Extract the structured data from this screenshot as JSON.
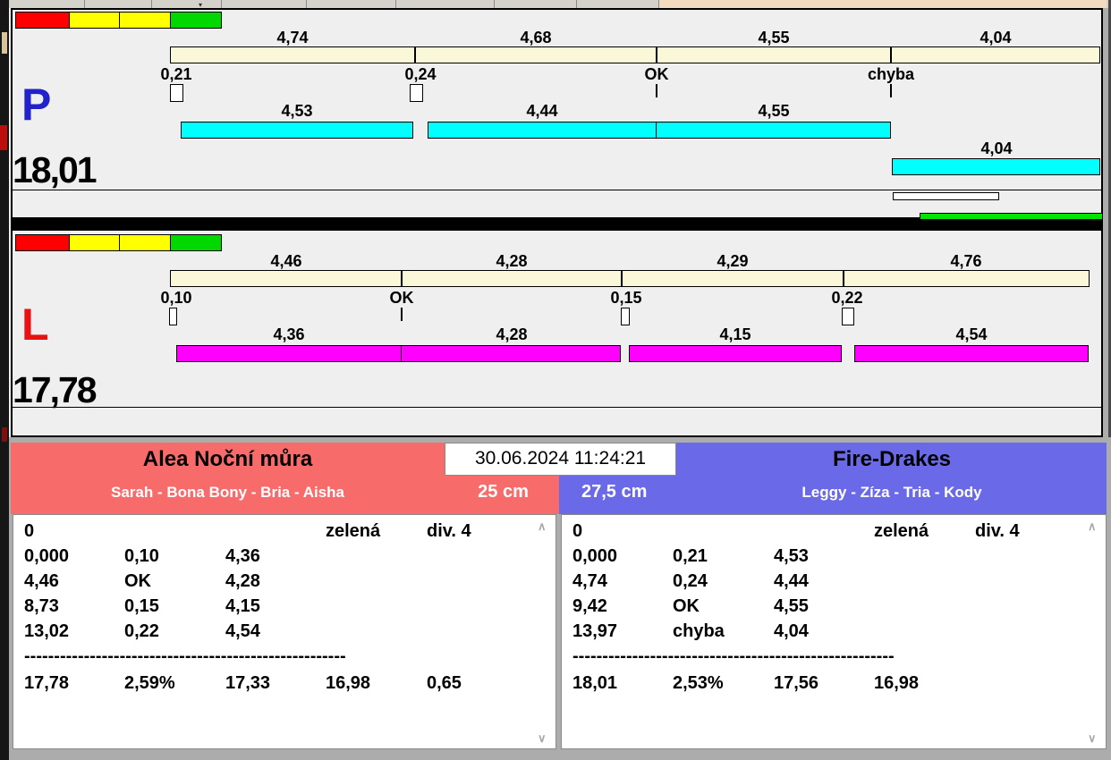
{
  "header": {
    "datetime": "30.06.2024 11:24:21"
  },
  "colors": {
    "cream_bar": "#FAF8D8",
    "cyan_bar": "#00FFFF",
    "magenta_bar": "#FF00FF",
    "green_bar": "#00E400",
    "traffic": [
      "#FF0000",
      "#FFFF00",
      "#FFFF00",
      "#00D800"
    ],
    "panel_red": "#F86B6B",
    "panel_blue": "#6A6AE8",
    "letter_p_blue": "#2222CC",
    "letter_l_red": "#E81212",
    "toolbar_peach": "#F3DBBF"
  },
  "lanes": [
    {
      "letter": "P",
      "total": "18,01",
      "split_bar": {
        "segments": [
          "4,74",
          "4,68",
          "4,55",
          "4,04"
        ]
      },
      "events": [
        "0,21",
        "0,24",
        "OK",
        "chyba"
      ],
      "run_bar": {
        "segments": [
          "4,53",
          "4,44",
          "4,55"
        ],
        "extra": "4,04"
      }
    },
    {
      "letter": "L",
      "total": "17,78",
      "split_bar": {
        "segments": [
          "4,46",
          "4,28",
          "4,29",
          "4,76"
        ]
      },
      "events": [
        "0,10",
        "OK",
        "0,15",
        "0,22"
      ],
      "run_bar": {
        "segments": [
          "4,36",
          "4,28",
          "4,15",
          "4,54"
        ]
      }
    }
  ],
  "panels": [
    {
      "team": "Alea Noční můra",
      "dogs": "Sarah - Bona Bony - Bria - Aisha",
      "height": "25 cm",
      "table": {
        "rows": [
          [
            "0",
            "",
            "",
            "zelená",
            "div. 4"
          ],
          [
            "0,000",
            "0,10",
            "4,36",
            "",
            ""
          ],
          [
            "4,46",
            "OK",
            "4,28",
            "",
            ""
          ],
          [
            "8,73",
            "0,15",
            "4,15",
            "",
            ""
          ],
          [
            "13,02",
            "0,22",
            "4,54",
            "",
            ""
          ]
        ],
        "divider": "------------------------------------------------------",
        "summary": [
          "17,78",
          "2,59%",
          "17,33",
          "16,98",
          "0,65"
        ]
      }
    },
    {
      "team": "Fire-Drakes",
      "dogs": "Leggy - Zíza - Tria - Kody",
      "height": "27,5 cm",
      "table": {
        "rows": [
          [
            "0",
            "",
            "",
            "zelená",
            "div. 4"
          ],
          [
            "0,000",
            "0,21",
            "4,53",
            "",
            ""
          ],
          [
            "4,74",
            "0,24",
            "4,44",
            "",
            ""
          ],
          [
            "9,42",
            "OK",
            "4,55",
            "",
            ""
          ],
          [
            "13,97",
            "chyba",
            "4,04",
            "",
            ""
          ]
        ],
        "divider": "------------------------------------------------------",
        "summary": [
          "18,01",
          "2,53%",
          "17,56",
          "16,98",
          ""
        ]
      }
    }
  ]
}
